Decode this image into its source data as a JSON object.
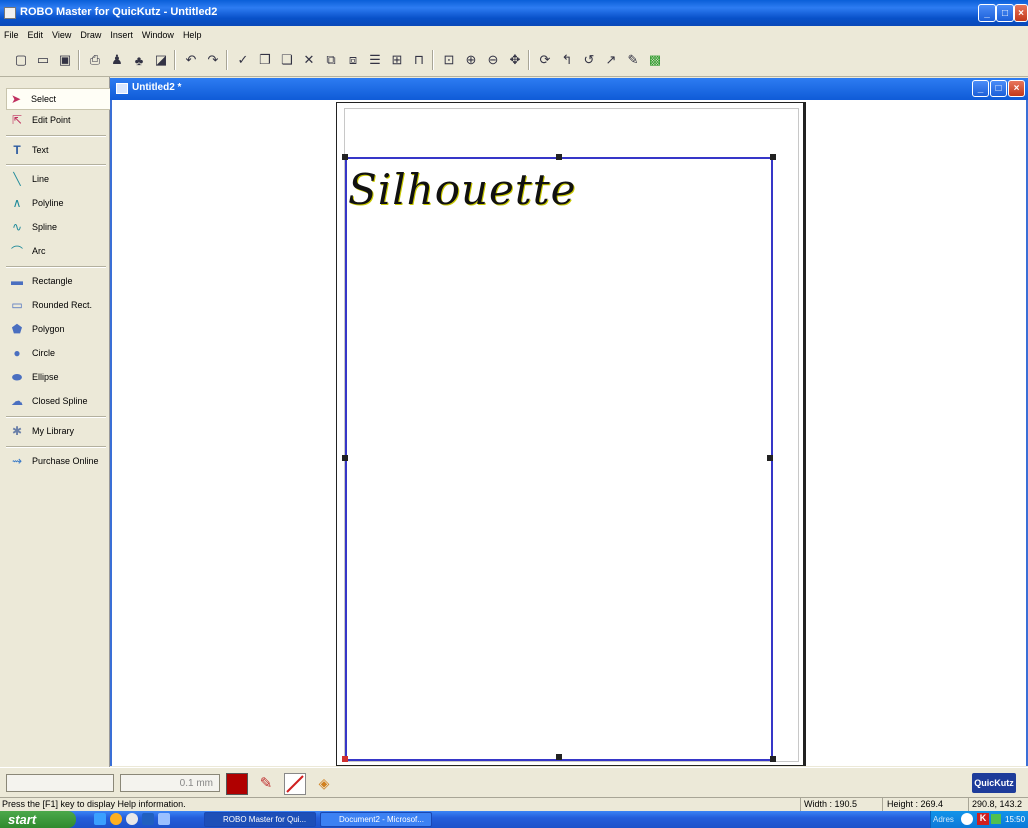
{
  "window": {
    "title": "ROBO Master for QuicKutz - Untitled2"
  },
  "menu": [
    "File",
    "Edit",
    "View",
    "Draw",
    "Insert",
    "Window",
    "Help"
  ],
  "toolbar_icons": [
    "new-icon",
    "open-icon",
    "save-icon",
    "print-icon",
    "plot-icon",
    "cut-out-icon",
    "preview-icon",
    "undo-icon",
    "redo-icon",
    "pointer-icon",
    "copy-icon",
    "paste-icon",
    "delete-icon",
    "group-icon",
    "ungroup-icon",
    "align-icon",
    "distribute-icon",
    "frame-icon",
    "zoom-fit-icon",
    "zoom-in-icon",
    "zoom-out-icon",
    "pan-icon",
    "rotate-icon",
    "back-icon",
    "forward-icon",
    "redo-arrow-icon",
    "pen-icon",
    "region-icon"
  ],
  "tools": [
    {
      "label": "Select",
      "icon": "select-arrow-icon"
    },
    {
      "label": "Edit Point",
      "icon": "edit-point-icon"
    },
    {
      "label": "Text",
      "icon": "text-icon"
    },
    {
      "label": "Line",
      "icon": "line-icon"
    },
    {
      "label": "Polyline",
      "icon": "polyline-icon"
    },
    {
      "label": "Spline",
      "icon": "spline-icon"
    },
    {
      "label": "Arc",
      "icon": "arc-icon"
    },
    {
      "label": "Rectangle",
      "icon": "rectangle-icon"
    },
    {
      "label": "Rounded Rect.",
      "icon": "rounded-rect-icon"
    },
    {
      "label": "Polygon",
      "icon": "polygon-icon"
    },
    {
      "label": "Circle",
      "icon": "circle-icon"
    },
    {
      "label": "Ellipse",
      "icon": "ellipse-icon"
    },
    {
      "label": "Closed Spline",
      "icon": "closed-spline-icon"
    },
    {
      "label": "My Library",
      "icon": "library-icon"
    },
    {
      "label": "Purchase Online",
      "icon": "purchase-icon"
    }
  ],
  "document": {
    "title": "Untitled2 *",
    "canvas_text": "Silhouette"
  },
  "propbar": {
    "line_width": "0.1 mm",
    "fill_color": "#b00000",
    "logo": "QuicKutz"
  },
  "status": {
    "help": "Press the [F1] key to display Help information.",
    "width": "Width : 190.5",
    "height": "Height : 269.4",
    "coords": "290.8, 143.2"
  },
  "taskbar": {
    "start": "start",
    "tasks": [
      "ROBO Master for Qui...",
      "Document2 - Microsof..."
    ],
    "tray_address": "Adres",
    "clock": "15:50"
  },
  "colors": {
    "titlebar": "#0a5fd8",
    "cut_border": "#3636c8",
    "taskbar": "#245edb"
  }
}
